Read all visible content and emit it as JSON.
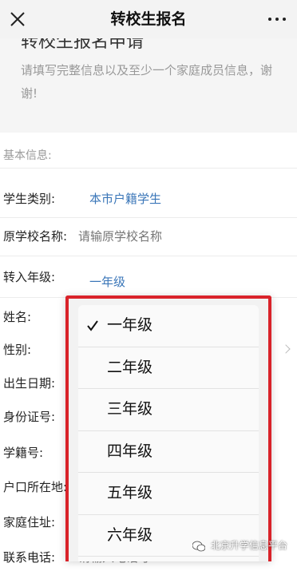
{
  "header": {
    "title": "转校生报名"
  },
  "intro": {
    "heading": "转校生报名申请",
    "text": "请填写完整信息以及至少一个家庭成员信息，谢谢!"
  },
  "form": {
    "section_label": "基本信息:",
    "fields": {
      "student_type": {
        "label": "学生类别:",
        "value": "本市户籍学生"
      },
      "school_name": {
        "label": "原学校名称:",
        "placeholder": "请输原学校名称"
      },
      "grade": {
        "label": "转入年级:",
        "value": "一年级"
      },
      "name": {
        "label": "姓名:"
      },
      "gender": {
        "label": "性别:"
      },
      "birth_date": {
        "label": "出生日期:"
      },
      "id_number": {
        "label": "身份证号:"
      },
      "student_number": {
        "label": "学籍号:"
      },
      "hukou_address": {
        "label": "户口所在地:"
      },
      "home_address": {
        "label": "家庭住址:"
      },
      "phone": {
        "label": "联系电话:",
        "placeholder": "请输入电话号"
      }
    }
  },
  "picker": {
    "selected_index": 0,
    "checkmark": "✓",
    "options": [
      "一年级",
      "二年级",
      "三年级",
      "四年级",
      "五年级",
      "六年级"
    ],
    "highlight_color": "#d9232a"
  },
  "watermark": {
    "text": "北京升学信息平台",
    "icon": "wechat-icon"
  },
  "colors": {
    "link_blue": "#3a76b8",
    "placeholder_gray": "#b9b9b9"
  }
}
